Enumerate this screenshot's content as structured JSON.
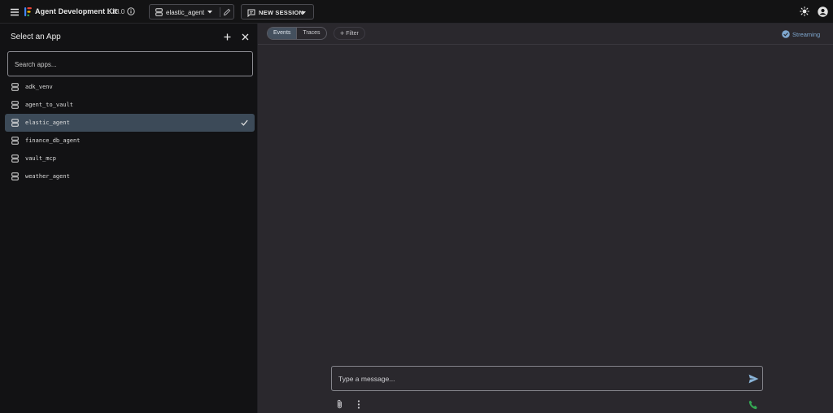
{
  "header": {
    "title": "Agent Development Kit",
    "version": "1.33.0",
    "selected_agent": "elastic_agent",
    "new_session_label": "NEW SESSION",
    "icons": [
      "menu-icon",
      "adk-logo-icon",
      "info-icon",
      "server-icon",
      "chevron-down-icon",
      "edit-icon",
      "chat-icon",
      "theme-sun-icon",
      "account-circle-icon"
    ]
  },
  "sidebar": {
    "title": "Select an App",
    "search_placeholder": "Search apps...",
    "apps": [
      {
        "name": "adk_venv",
        "selected": false
      },
      {
        "name": "agent_to_vault",
        "selected": false
      },
      {
        "name": "elastic_agent",
        "selected": true
      },
      {
        "name": "finance_db_agent",
        "selected": false
      },
      {
        "name": "vault_mcp",
        "selected": false
      },
      {
        "name": "weather_agent",
        "selected": false
      }
    ]
  },
  "main": {
    "tabs": [
      {
        "label": "Events",
        "active": true
      },
      {
        "label": "Traces",
        "active": false
      }
    ],
    "filter_label": "Filter",
    "streaming_label": "Streaming",
    "message_placeholder": "Type a message..."
  },
  "colors": {
    "background": "#2a282d",
    "sidebar": "#121214",
    "selected_item": "#3c4a58",
    "streaming_accent": "#7ea7cf",
    "call_green": "#34a853"
  }
}
